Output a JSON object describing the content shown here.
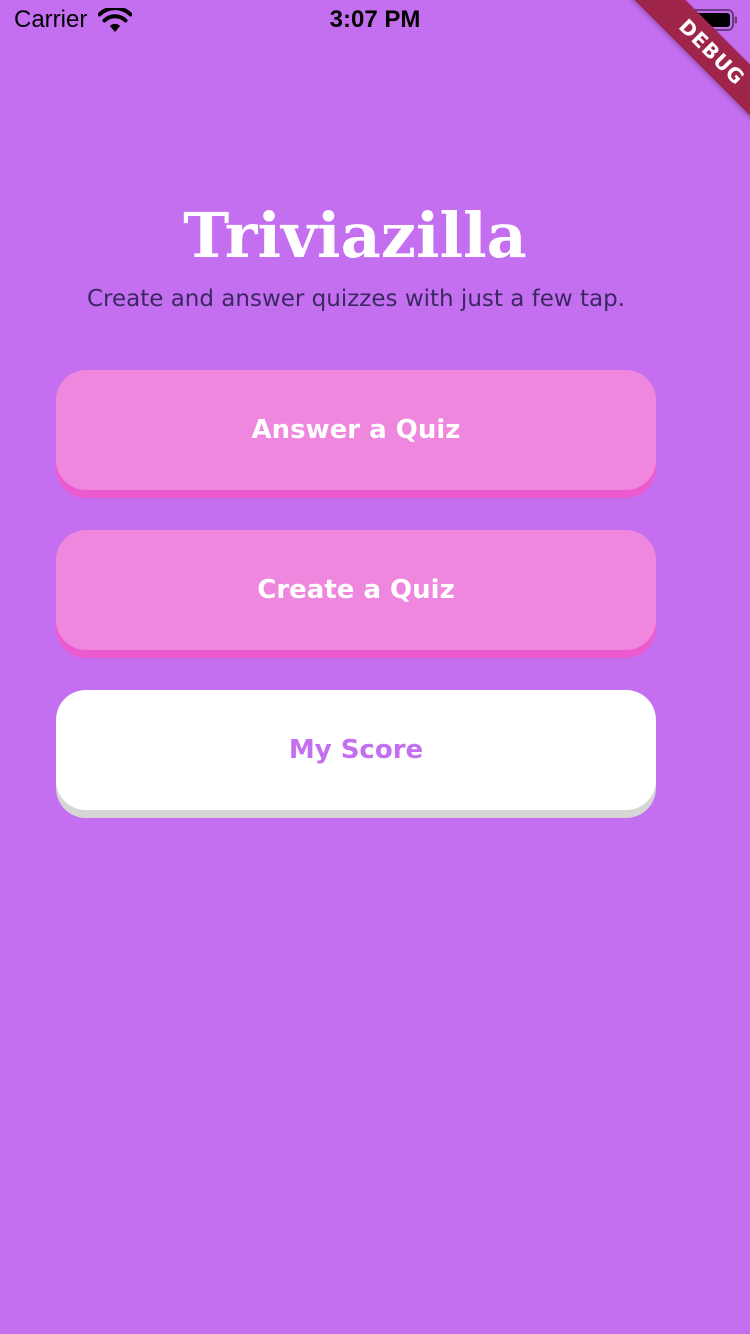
{
  "status_bar": {
    "carrier": "Carrier",
    "time": "3:07 PM",
    "wifi_icon": "wifi-icon",
    "battery_icon": "battery-icon"
  },
  "debug_banner": "DEBUG",
  "app": {
    "title": "Triviazilla",
    "subtitle": "Create and answer quizzes with just a few tap."
  },
  "buttons": {
    "answer": "Answer a Quiz",
    "create": "Create a Quiz",
    "score": "My Score"
  },
  "colors": {
    "background": "#c46ef0",
    "pink_button": "#f087df",
    "pink_button_shadow": "#ed5acf",
    "white_button": "#ffffff",
    "subtitle_text": "#3b2863",
    "debug_banner": "#a0254b"
  }
}
